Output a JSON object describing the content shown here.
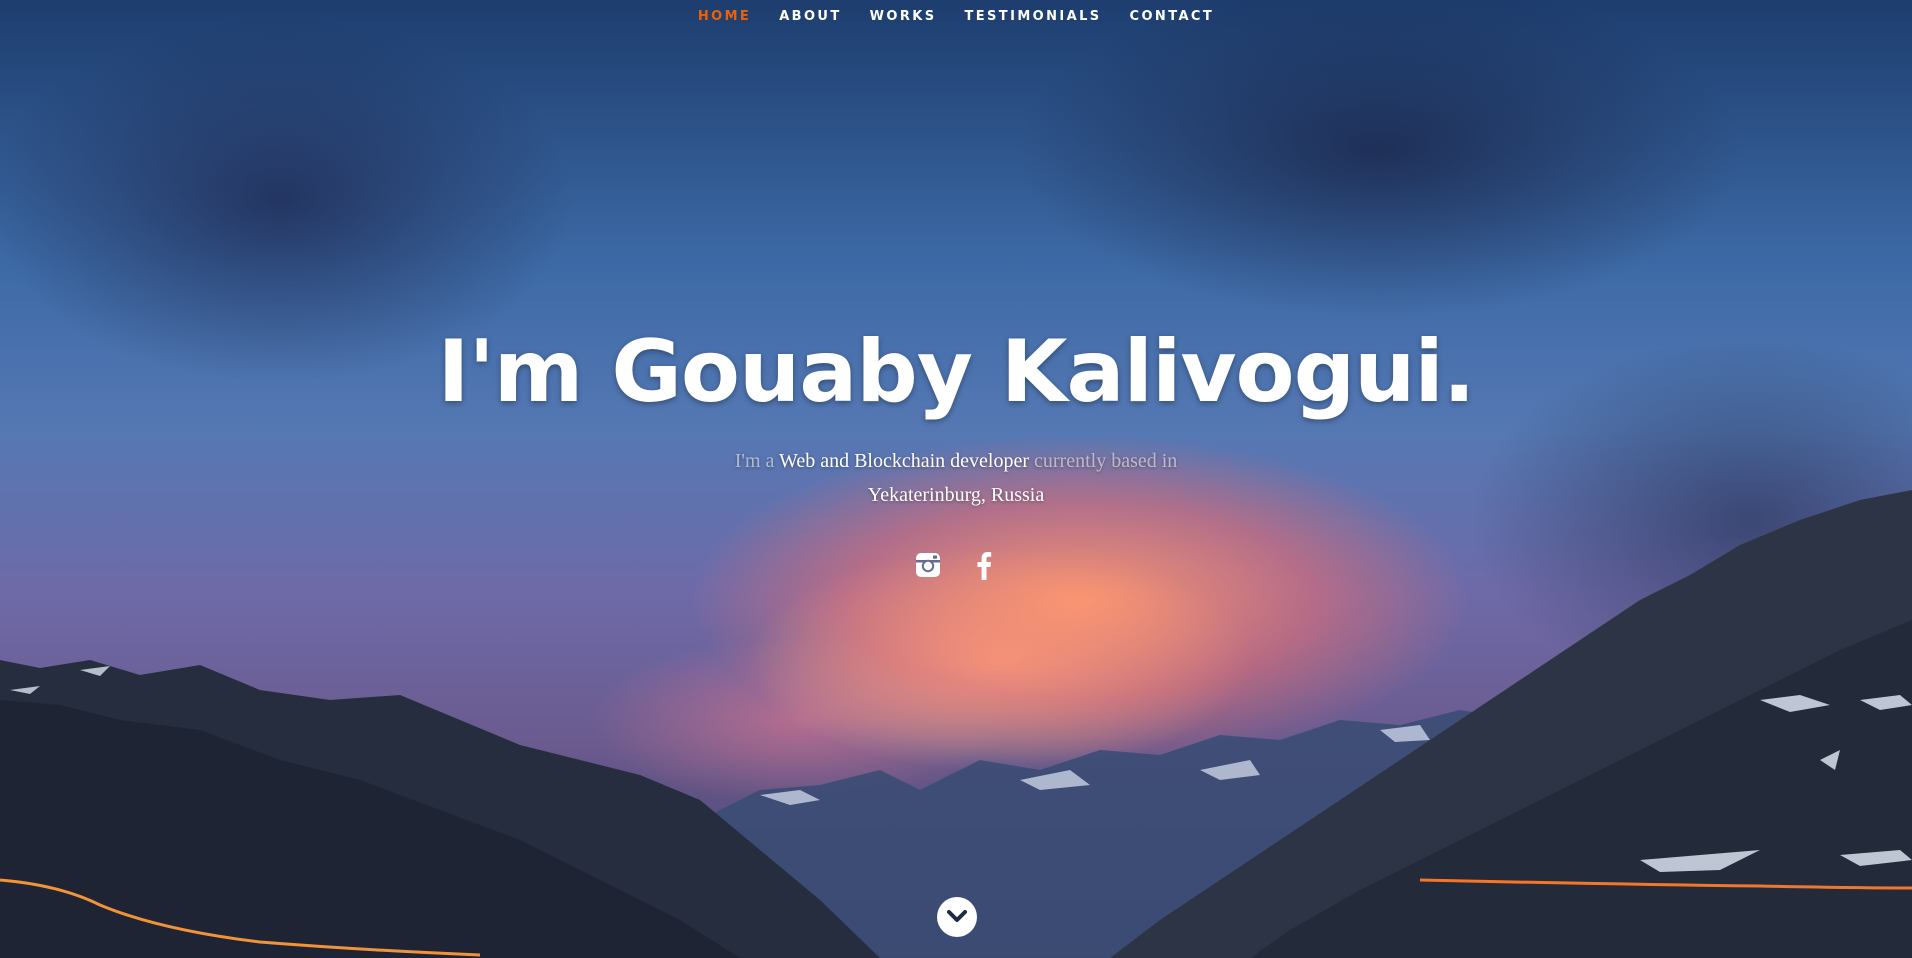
{
  "nav": {
    "items": [
      {
        "label": "HOME",
        "active": true
      },
      {
        "label": "ABOUT",
        "active": false
      },
      {
        "label": "WORKS",
        "active": false
      },
      {
        "label": "TESTIMONIALS",
        "active": false
      },
      {
        "label": "CONTACT",
        "active": false
      }
    ]
  },
  "hero": {
    "headline": "I'm Gouaby Kalivogui.",
    "tagline": {
      "part1": "I'm a ",
      "highlight1": "Web and Blockchain developer",
      "part2": " currently based in ",
      "highlight2": "Yekaterinburg, Russia"
    }
  },
  "social": {
    "icons": [
      "instagram-icon",
      "facebook-icon"
    ]
  },
  "scroll": {
    "icon": "chevron-down-icon"
  },
  "colors": {
    "accent": "#f06000",
    "text": "#ffffff"
  }
}
